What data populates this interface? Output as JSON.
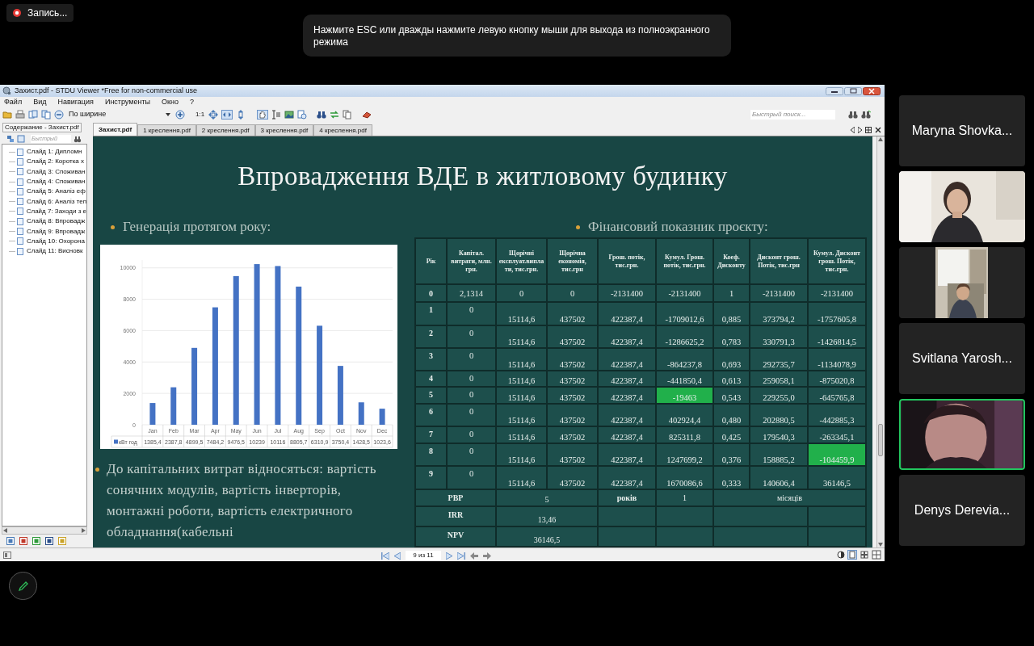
{
  "recording": {
    "label": "Запись..."
  },
  "notice": {
    "text": "Нажмите ESC или дважды нажмите левую кнопку мыши для выхода из полноэкранного режима"
  },
  "window": {
    "title": "Захист.pdf - STDU Viewer *Free for non-commercial use"
  },
  "menu": [
    "Файл",
    "Вид",
    "Навигация",
    "Инструменты",
    "Окно",
    "?"
  ],
  "toolbar": {
    "zoom_mode": "По ширине",
    "actual_size": "1:1",
    "search_placeholder": "Быстрый поиск..."
  },
  "sidebar": {
    "tab": "Содержание - Захист.pdf",
    "search_placeholder": "Быстрый",
    "items": [
      "Слайд 1: Дипломн",
      "Слайд 2: Коротка х",
      "Слайд 3: Споживан",
      "Слайд 4: Споживан",
      "Слайд 5: Аналіз еф",
      "Слайд 6: Аналіз теп",
      "Слайд 7: Заходи з е",
      "Слайд 8: Впровадж",
      "Слайд 9: Впровадж",
      "Слайд 10: Охорона",
      "Слайд 11: Висновк"
    ]
  },
  "tabs": [
    {
      "label": "Захист.pdf",
      "selected": true
    },
    {
      "label": "1 креслення.pdf",
      "selected": false
    },
    {
      "label": "2 креслення.pdf",
      "selected": false
    },
    {
      "label": "3 креслення.pdf",
      "selected": false
    },
    {
      "label": "4 креслення.pdf",
      "selected": false
    }
  ],
  "slide": {
    "title": "Впровадження ВДЕ в житловому будинку",
    "left_heading": "Генерація протягом року:",
    "chart_data": {
      "type": "bar",
      "categories": [
        "Jan",
        "Feb",
        "Mar",
        "Apr",
        "May",
        "Jun",
        "Jul",
        "Aug",
        "Sep",
        "Oct",
        "Nov",
        "Dec"
      ],
      "series": [
        {
          "name": "кВт год",
          "color": "#4472c4",
          "values": [
            1385.4,
            2387.8,
            4899.5,
            7484.2,
            9476.5,
            10239,
            10116,
            8805.7,
            6310.9,
            3750.4,
            1428.5,
            1023.6
          ]
        }
      ],
      "value_labels": [
        "1385,4",
        "2387,8",
        "4899,5",
        "7484,2",
        "9476,5",
        "10239",
        "10116",
        "8805,7",
        "6310,9",
        "3750,4",
        "1428,5",
        "1023,6"
      ],
      "yticks": [
        0,
        2000,
        4000,
        6000,
        8000,
        10000
      ],
      "ylim": [
        0,
        10500
      ],
      "grid": true
    },
    "note": "До капітальних витрат відносяться: вартість сонячних модулів, вартість інверторів, монтажні роботи, вартість електричного обладнання(кабельні",
    "right_heading": "Фінансовий показник проєкту:",
    "table": {
      "columns": [
        "Рік",
        "Капітал. витрати, млн. грн.",
        "Щорічні експлуат.виплати, тис.грн.",
        "Щорічна економія, тис.грн",
        "Грош. потік, тис.грн.",
        "Кумул. Грош. потік, тис.грн.",
        "Коеф. Дисконту",
        "Дисконт грош. Потік, тис.грн",
        "Кумул. Дисконт грош. Потік, тис.грн."
      ],
      "rows": [
        {
          "cells": [
            {
              "text": "0",
              "highlighted": false
            },
            {
              "text": "2,1314",
              "highlighted": false
            },
            {
              "text": "0",
              "highlighted": false
            },
            {
              "text": "0",
              "highlighted": false
            },
            {
              "text": "-2131400",
              "highlighted": false
            },
            {
              "text": "-2131400",
              "highlighted": false
            },
            {
              "text": "1",
              "highlighted": false
            },
            {
              "text": "-2131400",
              "highlighted": false
            },
            {
              "text": "-2131400",
              "highlighted": false
            }
          ]
        },
        {
          "cells": [
            {
              "text": "1",
              "highlighted": false
            },
            {
              "text": "0",
              "highlighted": false
            },
            {
              "text": "15114,6",
              "highlighted": false
            },
            {
              "text": "437502",
              "highlighted": false
            },
            {
              "text": "422387,4",
              "highlighted": false
            },
            {
              "text": "-1709012,6",
              "highlighted": false
            },
            {
              "text": "0,885",
              "highlighted": false
            },
            {
              "text": "373794,2",
              "highlighted": false
            },
            {
              "text": "-1757605,8",
              "highlighted": false
            }
          ]
        },
        {
          "cells": [
            {
              "text": "2",
              "highlighted": false
            },
            {
              "text": "0",
              "highlighted": false
            },
            {
              "text": "15114,6",
              "highlighted": false
            },
            {
              "text": "437502",
              "highlighted": false
            },
            {
              "text": "422387,4",
              "highlighted": false
            },
            {
              "text": "-1286625,2",
              "highlighted": false
            },
            {
              "text": "0,783",
              "highlighted": false
            },
            {
              "text": "330791,3",
              "highlighted": false
            },
            {
              "text": "-1426814,5",
              "highlighted": false
            }
          ]
        },
        {
          "cells": [
            {
              "text": "3",
              "highlighted": false
            },
            {
              "text": "0",
              "highlighted": false
            },
            {
              "text": "15114,6",
              "highlighted": false
            },
            {
              "text": "437502",
              "highlighted": false
            },
            {
              "text": "422387,4",
              "highlighted": false
            },
            {
              "text": "-864237,8",
              "highlighted": false
            },
            {
              "text": "0,693",
              "highlighted": false
            },
            {
              "text": "292735,7",
              "highlighted": false
            },
            {
              "text": "-1134078,9",
              "highlighted": false
            }
          ]
        },
        {
          "cells": [
            {
              "text": "4",
              "highlighted": false
            },
            {
              "text": "0",
              "highlighted": false
            },
            {
              "text": "15114,6",
              "highlighted": false
            },
            {
              "text": "437502",
              "highlighted": false
            },
            {
              "text": "422387,4",
              "highlighted": false
            },
            {
              "text": "-441850,4",
              "highlighted": false
            },
            {
              "text": "0,613",
              "highlighted": false
            },
            {
              "text": "259058,1",
              "highlighted": false
            },
            {
              "text": "-875020,8",
              "highlighted": false
            }
          ]
        },
        {
          "cells": [
            {
              "text": "5",
              "highlighted": false
            },
            {
              "text": "0",
              "highlighted": false
            },
            {
              "text": "15114,6",
              "highlighted": false
            },
            {
              "text": "437502",
              "highlighted": false
            },
            {
              "text": "422387,4",
              "highlighted": false
            },
            {
              "text": "-19463",
              "highlighted": true
            },
            {
              "text": "0,543",
              "highlighted": false
            },
            {
              "text": "229255,0",
              "highlighted": false
            },
            {
              "text": "-645765,8",
              "highlighted": false
            }
          ]
        },
        {
          "cells": [
            {
              "text": "6",
              "highlighted": false
            },
            {
              "text": "0",
              "highlighted": false
            },
            {
              "text": "15114,6",
              "highlighted": false
            },
            {
              "text": "437502",
              "highlighted": false
            },
            {
              "text": "422387,4",
              "highlighted": false
            },
            {
              "text": "402924,4",
              "highlighted": false
            },
            {
              "text": "0,480",
              "highlighted": false
            },
            {
              "text": "202880,5",
              "highlighted": false
            },
            {
              "text": "-442885,3",
              "highlighted": false
            }
          ]
        },
        {
          "cells": [
            {
              "text": "7",
              "highlighted": false
            },
            {
              "text": "0",
              "highlighted": false
            },
            {
              "text": "15114,6",
              "highlighted": false
            },
            {
              "text": "437502",
              "highlighted": false
            },
            {
              "text": "422387,4",
              "highlighted": false
            },
            {
              "text": "825311,8",
              "highlighted": false
            },
            {
              "text": "0,425",
              "highlighted": false
            },
            {
              "text": "179540,3",
              "highlighted": false
            },
            {
              "text": "-263345,1",
              "highlighted": false
            }
          ]
        },
        {
          "cells": [
            {
              "text": "8",
              "highlighted": false
            },
            {
              "text": "0",
              "highlighted": false
            },
            {
              "text": "15114,6",
              "highlighted": false
            },
            {
              "text": "437502",
              "highlighted": false
            },
            {
              "text": "422387,4",
              "highlighted": false
            },
            {
              "text": "1247699,2",
              "highlighted": false
            },
            {
              "text": "0,376",
              "highlighted": false
            },
            {
              "text": "158885,2",
              "highlighted": false
            },
            {
              "text": "-104459,9",
              "highlighted": true
            }
          ]
        },
        {
          "cells": [
            {
              "text": "9",
              "highlighted": false
            },
            {
              "text": "0",
              "highlighted": false
            },
            {
              "text": "15114,6",
              "highlighted": false
            },
            {
              "text": "437502",
              "highlighted": false
            },
            {
              "text": "422387,4",
              "highlighted": false
            },
            {
              "text": "1670086,6",
              "highlighted": false
            },
            {
              "text": "0,333",
              "highlighted": false
            },
            {
              "text": "140606,4",
              "highlighted": false
            },
            {
              "text": "36146,5",
              "highlighted": false
            }
          ]
        }
      ],
      "summary": [
        {
          "label": "PBP",
          "value": "5",
          "unit": "років",
          "value_2": "1",
          "unit_2": "місяців"
        },
        {
          "label": "IRR",
          "value": "13,46"
        },
        {
          "label": "NPV",
          "value": "36146,5"
        }
      ]
    }
  },
  "status_bar": {
    "page": "9 из 11"
  },
  "participants": [
    {
      "kind": "name",
      "name": "Maryna Shovka...",
      "speaking": false
    },
    {
      "kind": "video",
      "speaking": false
    },
    {
      "kind": "video",
      "speaking": false
    },
    {
      "kind": "name",
      "name": "Svitlana Yarosh...",
      "speaking": false
    },
    {
      "kind": "video",
      "speaking": true
    },
    {
      "kind": "name",
      "name": "Denys Derevia...",
      "speaking": false
    }
  ]
}
